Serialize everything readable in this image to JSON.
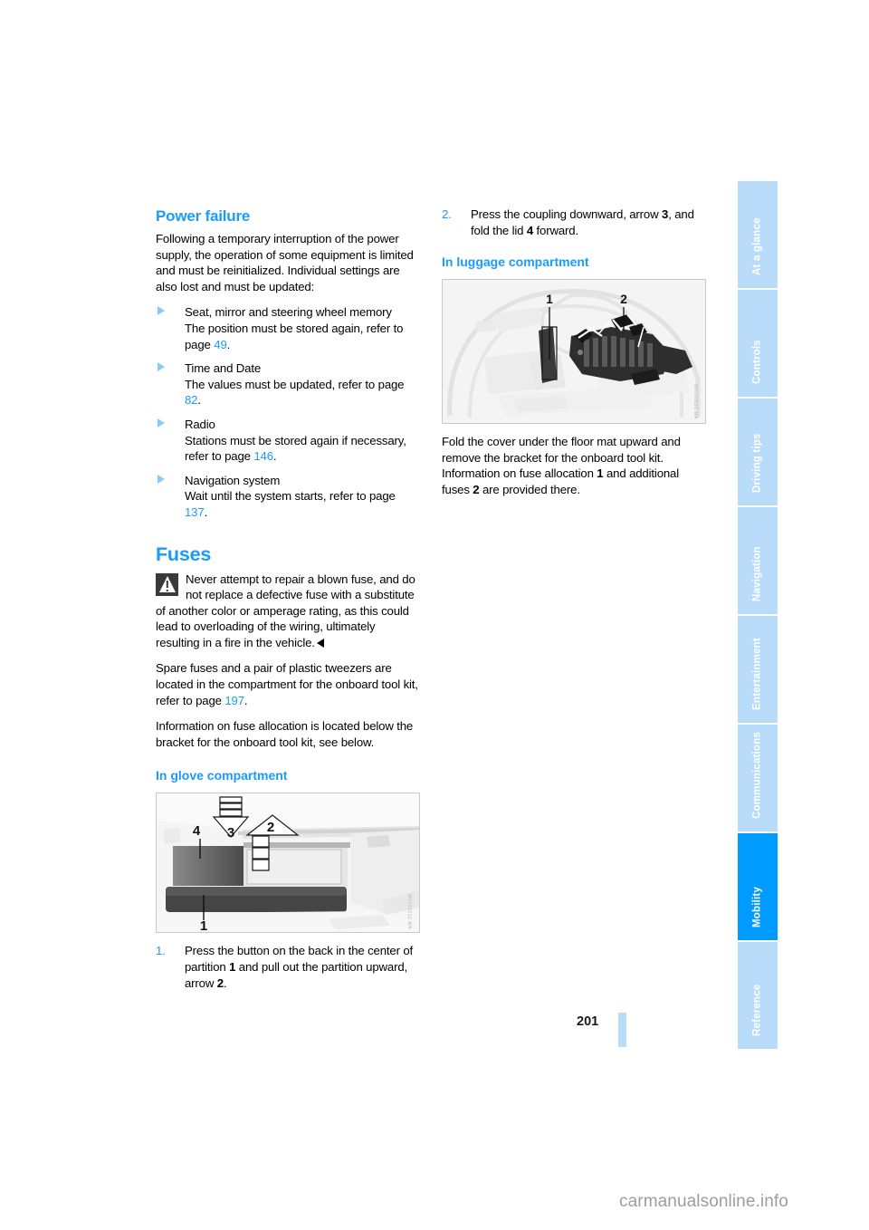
{
  "document": {
    "page_number": "201",
    "watermark": "carmanualsonline.info"
  },
  "left_column": {
    "power_failure": {
      "heading": "Power failure",
      "intro": "Following a temporary interruption of the power supply, the operation of some equipment is limited and must be reinitialized. Individual settings are also lost and must be updated:",
      "items": [
        {
          "title": "Seat, mirror and steering wheel memory",
          "detail_pre": "The position must be stored again, refer to page ",
          "page_ref": "49",
          "detail_post": "."
        },
        {
          "title": "Time and Date",
          "detail_pre": "The values must be updated, refer to page ",
          "page_ref": "82",
          "detail_post": "."
        },
        {
          "title": "Radio",
          "detail_pre": "Stations must be stored again if necessary, refer to page ",
          "page_ref": "146",
          "detail_post": "."
        },
        {
          "title": "Navigation system",
          "detail_pre": "Wait until the system starts, refer to page ",
          "page_ref": "137",
          "detail_post": "."
        }
      ]
    },
    "fuses": {
      "heading": "Fuses",
      "warning": "Never attempt to repair a blown fuse, and do not replace a defective fuse with a substitute of another color or amperage rating, as this could lead to overloading of the wiring, ultimately resulting in a fire in the vehicle.",
      "para_spare_pre": "Spare fuses and a pair of plastic tweezers are located in the compartment for the onboard tool kit, refer to page ",
      "para_spare_ref": "197",
      "para_spare_post": ".",
      "para_info": "Information on fuse allocation is located below the bracket for the onboard tool kit, see below.",
      "glove": {
        "heading": "In glove compartment",
        "figure_watermark": "WY03151C.MA",
        "figure_callouts": [
          "1",
          "2",
          "3",
          "4"
        ],
        "step_number": "1.",
        "step_text_a": "Press the button on the back in the center of partition ",
        "step_bold_a": "1",
        "step_text_b": " and pull out the partition upward, arrow ",
        "step_bold_b": "2",
        "step_text_c": "."
      }
    }
  },
  "right_column": {
    "step2": {
      "number": "2.",
      "text_a": "Press the coupling downward, arrow ",
      "bold_a": "3",
      "text_b": ", and fold the lid ",
      "bold_b": "4",
      "text_c": " forward."
    },
    "luggage": {
      "heading": "In luggage compartment",
      "figure_watermark": "WY03052C.MA",
      "figure_callouts": [
        "1",
        "2"
      ],
      "text_a": "Fold the cover under the floor mat upward and remove the bracket for the onboard tool kit. Information on fuse allocation ",
      "bold_a": "1",
      "text_b": " and additional fuses ",
      "bold_b": "2",
      "text_c": " are provided there."
    }
  },
  "sidebar": {
    "tabs": [
      {
        "label": "At a glance",
        "active": false
      },
      {
        "label": "Controls",
        "active": false
      },
      {
        "label": "Driving tips",
        "active": false
      },
      {
        "label": "Navigation",
        "active": false
      },
      {
        "label": "Entertainment",
        "active": false
      },
      {
        "label": "Communications",
        "active": false
      },
      {
        "label": "Mobility",
        "active": true
      },
      {
        "label": "Reference",
        "active": false
      }
    ]
  },
  "colors": {
    "accent_blue": "#1a9bfc",
    "tab_inactive": "#b9dcfb",
    "tab_active": "#009bff",
    "text": "#000000"
  }
}
